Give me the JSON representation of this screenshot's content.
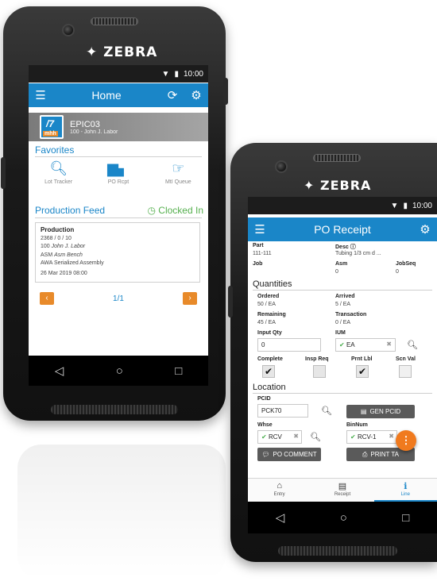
{
  "brand": "ZEBRA",
  "status_time": "10:00",
  "home": {
    "title": "Home",
    "user": {
      "company": "EPIC03",
      "line": "100 - John J. Labor"
    },
    "favorites_title": "Favorites",
    "favorites": [
      {
        "label": "Lot Tracker",
        "icon": "search-icon"
      },
      {
        "label": "PO Rcpt",
        "icon": "truck-icon"
      },
      {
        "label": "MtI Queue",
        "icon": "hand-point-icon"
      }
    ],
    "feed_title": "Production Feed",
    "clocked": "Clocked In",
    "feed_card": {
      "title": "Production",
      "qty": "2368 / 0 / 10",
      "emp_id": "100",
      "emp_name": "John J. Labor",
      "asm_label": "ASM",
      "asm_value": "Asm Bench",
      "desc": "AWA Serialized Assembly",
      "date": "26 Mar 2019 08:00"
    },
    "page": "1/1"
  },
  "po": {
    "title": "PO Receipt",
    "part_label": "Part",
    "part_value": "111-111",
    "desc_label": "Desc",
    "desc_value": "Tubing 1/3 cm d ...",
    "job_label": "Job",
    "asm_label": "Asm",
    "asm_value": "0",
    "jobseq_label": "JobSeq",
    "jobseq_value": "0",
    "quantities_title": "Quantities",
    "ordered_label": "Ordered",
    "ordered_value": "50 / EA",
    "arrived_label": "Arrived",
    "arrived_value": "5 / EA",
    "remaining_label": "Remaining",
    "remaining_value": "45 / EA",
    "transaction_label": "Transaction",
    "transaction_value": "0 / EA",
    "input_qty_label": "Input Qty",
    "input_qty_value": "0",
    "ium_label": "IUM",
    "ium_value": "EA",
    "complete_label": "Complete",
    "insp_req_label": "Insp Req",
    "prnt_lbl_label": "Prnt Lbl",
    "scn_val_label": "Scn Val",
    "location_title": "Location",
    "pcid_label": "PCID",
    "pcid_value": "PCK70",
    "gen_pcid": "GEN PCID",
    "whse_label": "Whse",
    "whse_value": "RCV",
    "binnum_label": "BinNum",
    "binnum_value": "RCV-1",
    "po_comment": "PO COMMENT",
    "print_tag": "PRINT TA",
    "fab": "⋮",
    "tabs": [
      {
        "label": "Entry",
        "icon": "dock-icon"
      },
      {
        "label": "Receipt",
        "icon": "document-icon"
      },
      {
        "label": "Line",
        "icon": "info-icon"
      }
    ]
  }
}
